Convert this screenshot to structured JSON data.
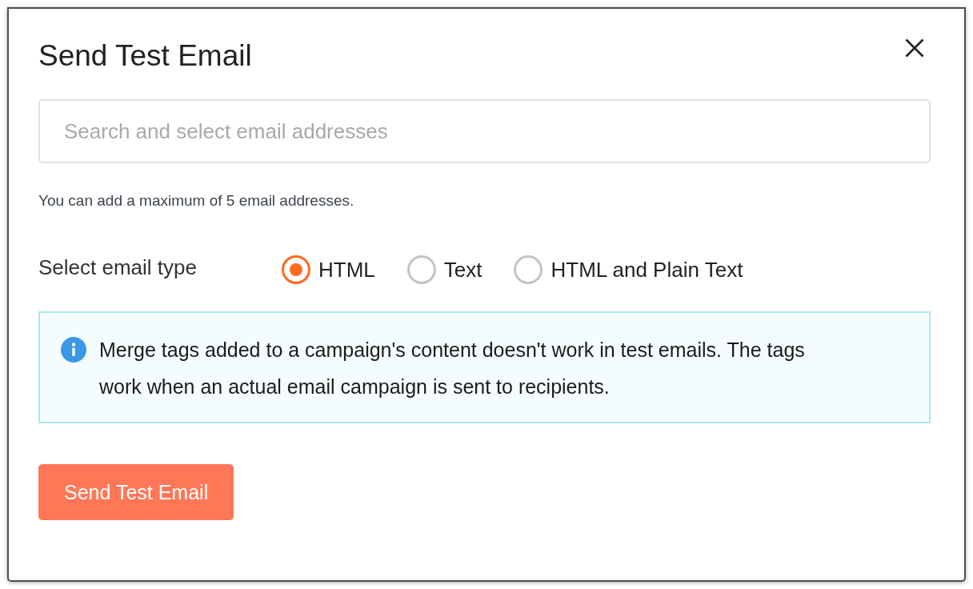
{
  "dialog": {
    "title": "Send Test Email"
  },
  "recipients_field": {
    "placeholder": "Search and select email addresses"
  },
  "recipients_hint": "You can add a maximum of 5 email addresses.",
  "email_type": {
    "label": "Select email type",
    "options": [
      {
        "label": "HTML",
        "selected": true
      },
      {
        "label": "Text",
        "selected": false
      },
      {
        "label": "HTML and Plain Text",
        "selected": false
      }
    ]
  },
  "notice": {
    "text": "Merge tags added to a campaign's content doesn't work in test emails. The tags work when an actual email campaign is sent to recipients."
  },
  "buttons": [
    {
      "label": "Send Test Email"
    }
  ]
}
